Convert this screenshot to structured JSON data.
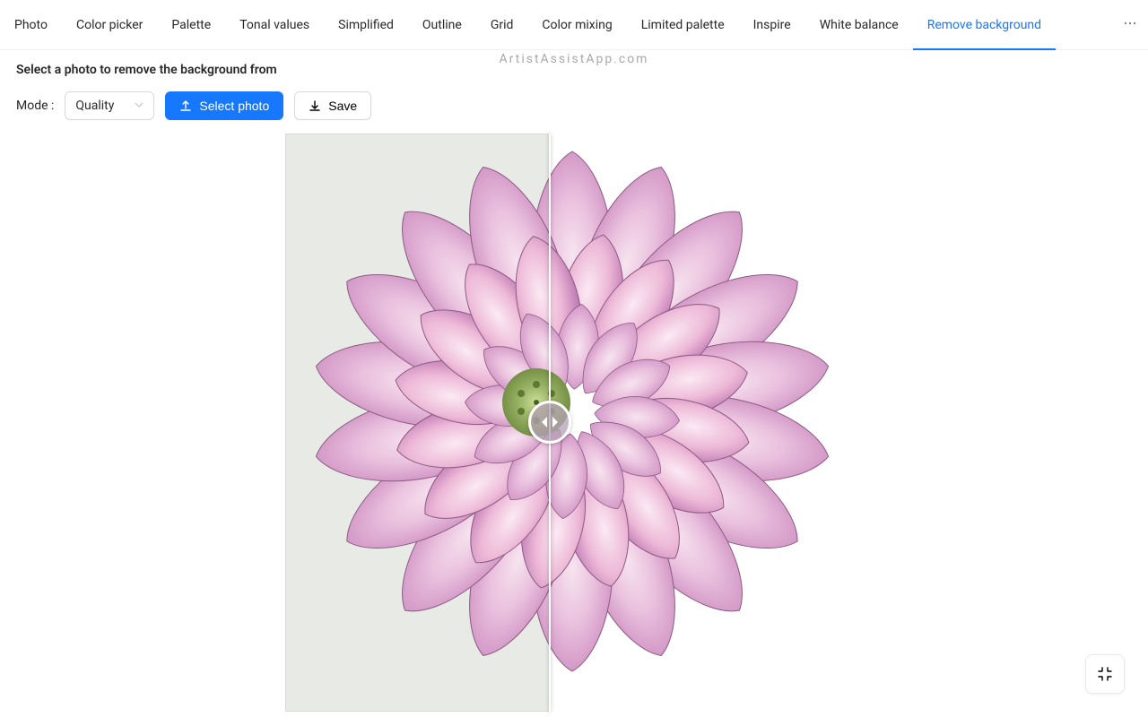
{
  "tabs": {
    "items": [
      {
        "label": "Photo",
        "active": false
      },
      {
        "label": "Color picker",
        "active": false
      },
      {
        "label": "Palette",
        "active": false
      },
      {
        "label": "Tonal values",
        "active": false
      },
      {
        "label": "Simplified",
        "active": false
      },
      {
        "label": "Outline",
        "active": false
      },
      {
        "label": "Grid",
        "active": false
      },
      {
        "label": "Color mixing",
        "active": false
      },
      {
        "label": "Limited palette",
        "active": false
      },
      {
        "label": "Inspire",
        "active": false
      },
      {
        "label": "White balance",
        "active": false
      },
      {
        "label": "Remove background",
        "active": true
      }
    ],
    "overflow_icon": "ellipsis"
  },
  "watermark": "ArtistAssistApp.com",
  "instruction": "Select a photo to remove the background from",
  "controls": {
    "mode_label": "Mode :",
    "mode_value": "Quality",
    "select_photo_label": "Select photo",
    "save_label": "Save"
  },
  "compare": {
    "slider_position_percent": 47,
    "handle_icon": "compare-arrows"
  },
  "fullscreen_icon": "compress"
}
